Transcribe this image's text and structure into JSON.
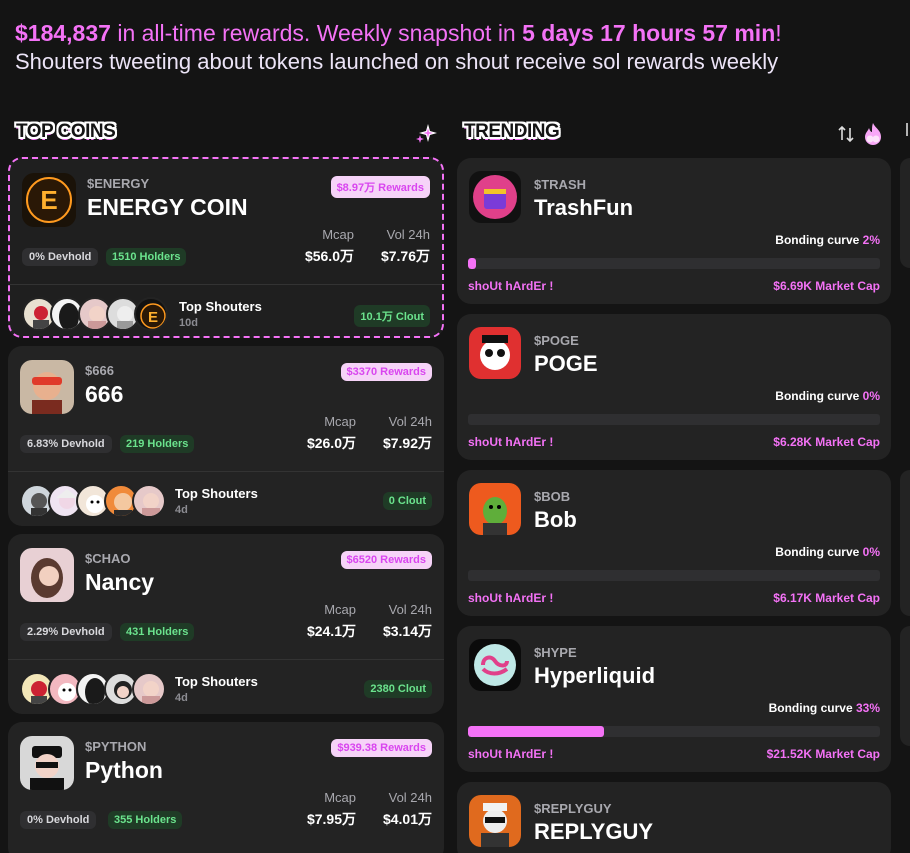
{
  "banner": {
    "rewards_amount": "$184,837",
    "rewards_text": " in all-time rewards. Weekly snapshot in ",
    "countdown": "5 days 17 hours 57 min",
    "exclaim": "!",
    "subtitle": "Shouters tweeting about tokens launched on shout receive sol rewards weekly"
  },
  "top_coins": {
    "title": "TOP COINS",
    "mcap_label": "Mcap",
    "vol_label": "Vol 24h",
    "top_shouters_label": "Top Shouters",
    "items": [
      {
        "ticker": "$ENERGY",
        "name": "ENERGY COIN",
        "rewards": "$8.97万 Rewards",
        "devhold": "0% Devhold",
        "holders": "1510 Holders",
        "mcap": "$56.0万",
        "vol": "$7.76万",
        "time": "10d",
        "clout": "10.1万 Clout"
      },
      {
        "ticker": "$666",
        "name": "666",
        "rewards": "$3370 Rewards",
        "devhold": "6.83% Devhold",
        "holders": "219 Holders",
        "mcap": "$26.0万",
        "vol": "$7.92万",
        "time": "4d",
        "clout": "0 Clout"
      },
      {
        "ticker": "$CHAO",
        "name": "Nancy",
        "rewards": "$6520 Rewards",
        "devhold": "2.29% Devhold",
        "holders": "431 Holders",
        "mcap": "$24.1万",
        "vol": "$3.14万",
        "time": "4d",
        "clout": "2380 Clout"
      },
      {
        "ticker": "$PYTHON",
        "name": "Python",
        "rewards": "$939.38 Rewards",
        "devhold": "0% Devhold",
        "holders": "355 Holders",
        "mcap": "$7.95万",
        "vol": "$4.01万"
      }
    ]
  },
  "trending": {
    "title": "TRENDING",
    "bonding_label": "Bonding curve",
    "shout_label": "shoUt hArdEr !",
    "items": [
      {
        "ticker": "$TRASH",
        "name": "TrashFun",
        "bonding_pct": "2%",
        "progress": 0.02,
        "mcap": "$6.69K Market Cap"
      },
      {
        "ticker": "$POGE",
        "name": "POGE",
        "bonding_pct": "0%",
        "progress": 0,
        "mcap": "$6.28K Market Cap"
      },
      {
        "ticker": "$BOB",
        "name": "Bob",
        "bonding_pct": "0%",
        "progress": 0,
        "mcap": "$6.17K Market Cap"
      },
      {
        "ticker": "$HYPE",
        "name": "Hyperliquid",
        "bonding_pct": "33%",
        "progress": 0.33,
        "mcap": "$21.52K Market Cap"
      },
      {
        "ticker": "$REPLYGUY",
        "name": "REPLYGUY"
      }
    ]
  },
  "colors": {
    "accent": "#f472f6",
    "positive": "#6be38d",
    "card": "#232323",
    "background": "#141414"
  },
  "icons": [
    "sparkle-icon",
    "sort-icon",
    "flame-icon"
  ]
}
